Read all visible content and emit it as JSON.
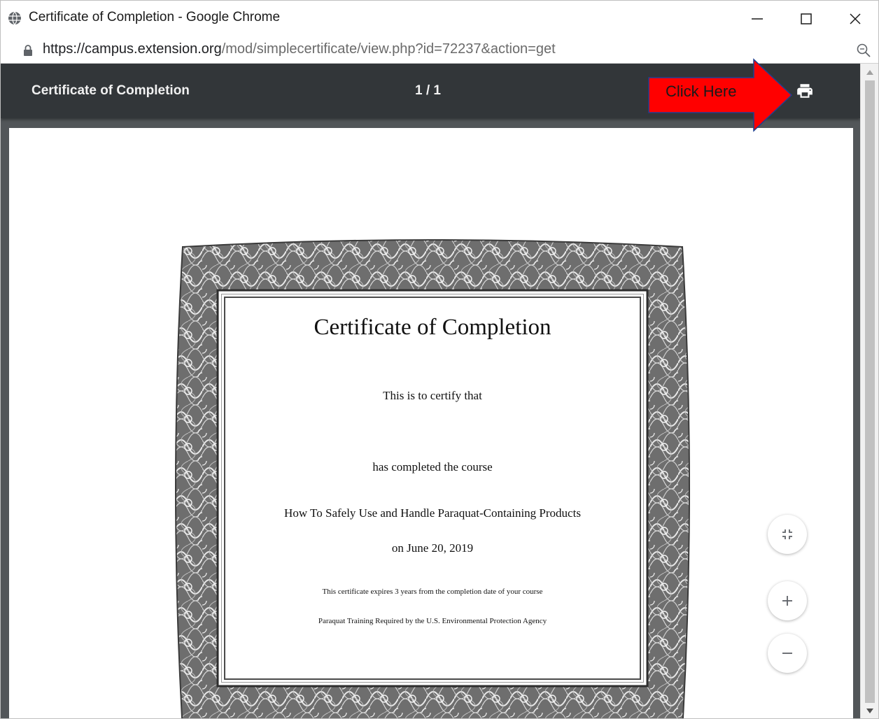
{
  "window": {
    "title": "Certificate of Completion - Google Chrome",
    "icon": "globe-icon",
    "controls": [
      "minimize-icon",
      "maximize-icon",
      "close-icon"
    ]
  },
  "address_bar": {
    "url_host": "https://campus.extension.org",
    "url_path": "/mod/simplecertificate/view.php?id=72237&action=get",
    "lock_icon": "lock-icon",
    "zoom_icon": "zoom-icon"
  },
  "viewer": {
    "title": "Certificate of Completion",
    "page_indicator": "1 / 1",
    "print_icon": "print-icon",
    "toolbar_color": "#323639",
    "background_color": "#525659"
  },
  "annotation": {
    "label": "Click Here",
    "arrow_color": "#ff0000"
  },
  "certificate": {
    "title": "Certificate of Completion",
    "certify_line": "This is to certify that",
    "completed_line": "has completed the course",
    "course_name": "How To Safely Use and Handle Paraquat-Containing Products",
    "date_line": "on June 20, 2019",
    "expires_line": "This certificate expires 3 years from the completion date of your course",
    "required_line": "Paraquat Training Required by the U.S. Environmental Protection Agency"
  },
  "zoom_controls": [
    "fit-to-page-icon",
    "zoom-in-icon",
    "zoom-out-icon"
  ]
}
